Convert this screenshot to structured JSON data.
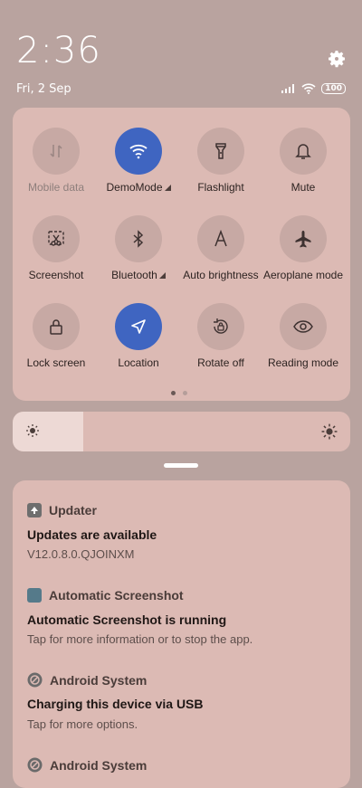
{
  "status": {
    "time": "2:36",
    "date": "Fri, 2 Sep",
    "battery": "100"
  },
  "quick_settings": {
    "tiles": [
      {
        "label": "Mobile data",
        "icon": "mobile-data-icon",
        "active": false,
        "disabled": true
      },
      {
        "label": "DemoMode",
        "icon": "wifi-icon",
        "active": true,
        "has_caret": true
      },
      {
        "label": "Flashlight",
        "icon": "flashlight-icon",
        "active": false
      },
      {
        "label": "Mute",
        "icon": "bell-icon",
        "active": false
      },
      {
        "label": "Screenshot",
        "icon": "screenshot-icon",
        "active": false
      },
      {
        "label": "Bluetooth",
        "icon": "bluetooth-icon",
        "active": false,
        "has_caret": true
      },
      {
        "label": "Auto brightness",
        "icon": "auto-brightness-icon",
        "active": false
      },
      {
        "label": "Aeroplane mode",
        "icon": "airplane-icon",
        "active": false
      },
      {
        "label": "Lock screen",
        "icon": "lock-icon",
        "active": false
      },
      {
        "label": "Location",
        "icon": "location-icon",
        "active": true
      },
      {
        "label": "Rotate off",
        "icon": "rotate-icon",
        "active": false
      },
      {
        "label": "Reading mode",
        "icon": "eye-icon",
        "active": false
      }
    ],
    "page_count": 2,
    "current_page": 1
  },
  "brightness": {
    "level": 0.21
  },
  "notifications": [
    {
      "app": "Updater",
      "title": "Updates are available",
      "body": "V12.0.8.0.QJOINXM"
    },
    {
      "app": "Automatic Screenshot",
      "title": "Automatic Screenshot is running",
      "body": "Tap for more information or to stop the app."
    },
    {
      "app": "Android System",
      "title": "Charging this device via USB",
      "body": "Tap for more options."
    },
    {
      "app": "Android System",
      "title": "",
      "body": ""
    }
  ],
  "colors": {
    "background": "#b9a39f",
    "panel": "#dcbab4",
    "accent": "#3f65c1"
  }
}
